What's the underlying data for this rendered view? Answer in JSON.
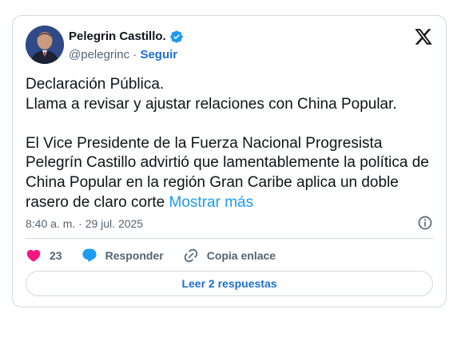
{
  "author": {
    "name": "Pelegrin Castillo.",
    "handle": "@pelegrinc",
    "separator": "·",
    "follow_label": "Seguir",
    "avatar_icon": "profile-photo",
    "verified_icon": "verified-badge-icon",
    "verified_color": "#1d9bf0"
  },
  "platform_icon": "x-logo-icon",
  "post": {
    "line1": "Declaración Pública.",
    "line2": "Llama a revisar y ajustar relaciones con China Popular.",
    "paragraph": "El Vice Presidente de la Fuerza Nacional Progresista Pelegrín Castillo advirtió que lamentablemente la política de China Popular en la región Gran Caribe aplica un doble rasero de claro corte ",
    "show_more": "Mostrar más",
    "timestamp": "8:40 a. m. · 29 jul. 2025"
  },
  "actions": {
    "likes_count": "23",
    "reply_label": "Responder",
    "copy_label": "Copia enlace",
    "like_color": "#f91880",
    "reply_color": "#1d9bf0"
  },
  "read_replies_label": "Leer 2 respuestas"
}
